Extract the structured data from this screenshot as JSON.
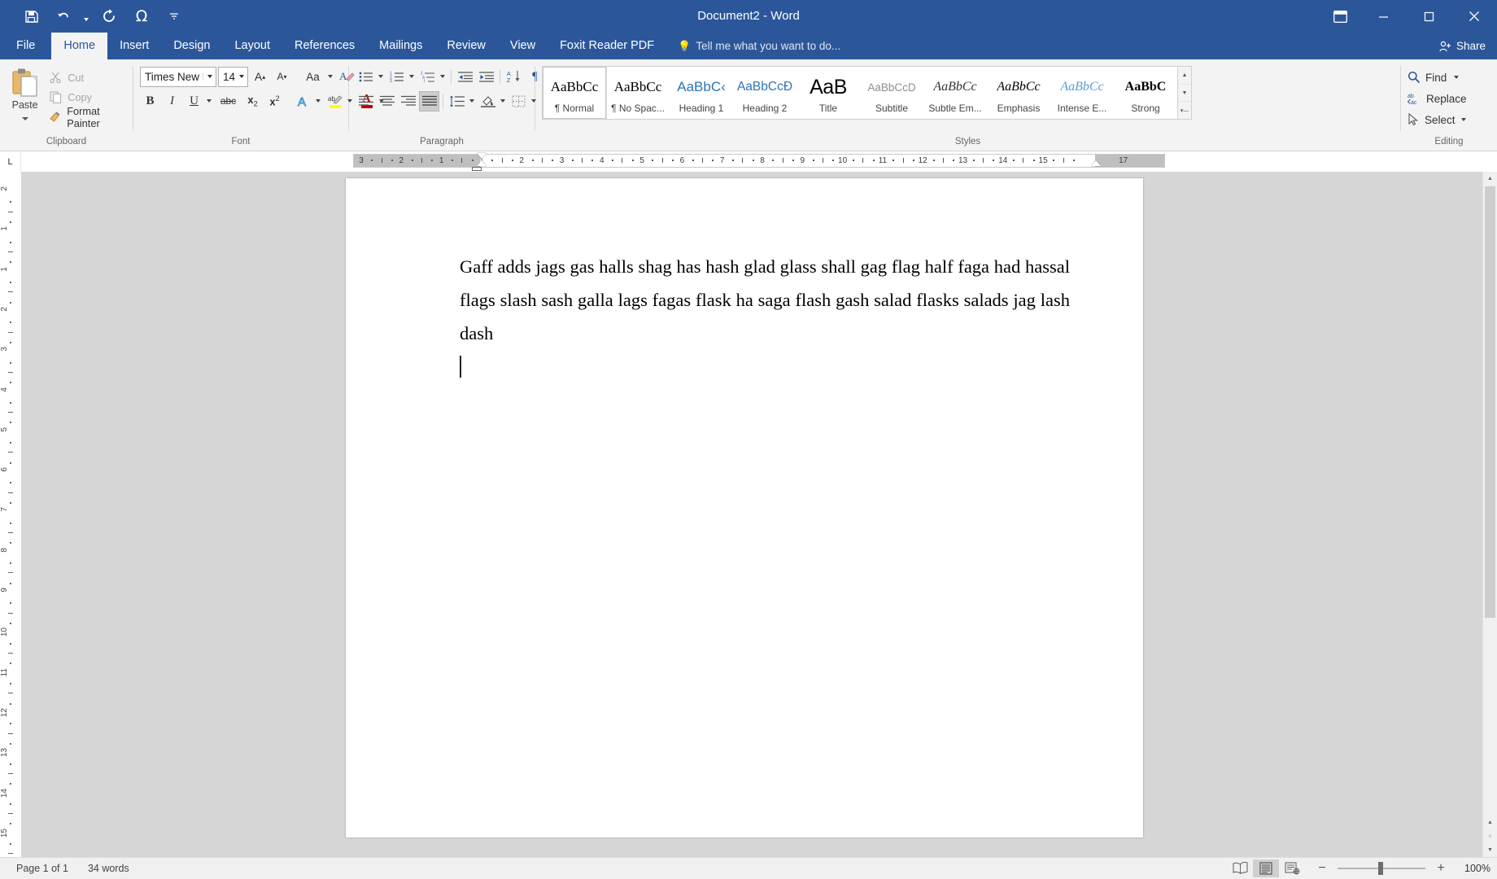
{
  "window": {
    "title": "Document2 - Word",
    "quick_access": [
      {
        "name": "save",
        "icon": "save-icon"
      },
      {
        "name": "undo",
        "icon": "undo-icon"
      },
      {
        "name": "redo",
        "icon": "redo-icon"
      },
      {
        "name": "symbol",
        "icon": "omega-icon",
        "glyph": "Ω"
      },
      {
        "name": "customize",
        "icon": "customize-qat-icon"
      }
    ],
    "controls": {
      "ribbon_display": "ribbon-display-options-icon",
      "minimize": "−",
      "restore": "❐",
      "close": "✕"
    }
  },
  "tabs": [
    {
      "label": "File",
      "active": false
    },
    {
      "label": "Home",
      "active": true
    },
    {
      "label": "Insert",
      "active": false
    },
    {
      "label": "Design",
      "active": false
    },
    {
      "label": "Layout",
      "active": false
    },
    {
      "label": "References",
      "active": false
    },
    {
      "label": "Mailings",
      "active": false
    },
    {
      "label": "Review",
      "active": false
    },
    {
      "label": "View",
      "active": false
    },
    {
      "label": "Foxit Reader PDF",
      "active": false
    }
  ],
  "tell_me": "Tell me what you want to do...",
  "share": "Share",
  "ribbon": {
    "clipboard": {
      "label": "Clipboard",
      "paste": "Paste",
      "commands": [
        {
          "label": "Cut",
          "icon": "scissors-icon",
          "enabled": false
        },
        {
          "label": "Copy",
          "icon": "copy-icon",
          "enabled": false
        },
        {
          "label": "Format Painter",
          "icon": "format-painter-icon",
          "enabled": true
        }
      ]
    },
    "font": {
      "label": "Font",
      "font_name": "Times New R‹",
      "font_name_full": "Times New Roman",
      "font_size": "14",
      "grow_font": "A",
      "shrink_font": "A",
      "change_case": "Aa",
      "clear_formatting": "clear-formatting-icon",
      "bold": "B",
      "italic": "I",
      "underline": "U",
      "strikethrough": "abc",
      "subscript": "x₂",
      "superscript": "x²",
      "text_effects": "A",
      "highlight": "ab",
      "font_color": "A",
      "highlight_color": "#ffff00",
      "font_color_value": "#c00000"
    },
    "paragraph": {
      "label": "Paragraph",
      "bullets": "bullets-icon",
      "numbering": "numbering-icon",
      "multilevel": "multilevel-list-icon",
      "decrease_indent": "decrease-indent-icon",
      "increase_indent": "increase-indent-icon",
      "sort": "sort-icon",
      "show_marks": "¶",
      "align_left": "align-left-icon",
      "align_center": "align-center-icon",
      "align_right": "align-right-icon",
      "justify": "justify-icon",
      "justify_active": true,
      "line_spacing": "line-spacing-icon",
      "shading": "shading-icon",
      "borders": "borders-icon"
    },
    "styles": {
      "label": "Styles",
      "items": [
        {
          "preview": "AaBbCc",
          "name": "¶ Normal",
          "kind": "normal",
          "selected": true
        },
        {
          "preview": "AaBbCc",
          "name": "¶ No Spac...",
          "kind": "nospace",
          "selected": false
        },
        {
          "preview": "AaBbC‹",
          "name": "Heading 1",
          "kind": "h1",
          "selected": false
        },
        {
          "preview": "AaBbCcĐ",
          "name": "Heading 2",
          "kind": "h2",
          "selected": false
        },
        {
          "preview": "AaB",
          "name": "Title",
          "kind": "title",
          "selected": false
        },
        {
          "preview": "AaBbCcD",
          "name": "Subtitle",
          "kind": "subtitle",
          "selected": false
        },
        {
          "preview": "AaBbCc",
          "name": "Subtle Em...",
          "kind": "subem",
          "selected": false
        },
        {
          "preview": "AaBbCc",
          "name": "Emphasis",
          "kind": "emph",
          "selected": false
        },
        {
          "preview": "AaBbCc",
          "name": "Intense E...",
          "kind": "intense",
          "selected": false
        },
        {
          "preview": "AaBbC",
          "name": "Strong",
          "kind": "strong",
          "selected": false
        }
      ]
    },
    "editing": {
      "label": "Editing",
      "find": "Find",
      "replace": "Replace",
      "select": "Select"
    }
  },
  "ruler": {
    "corner_tab": "L",
    "ticks": [
      "3",
      "2",
      "1",
      "1",
      "2",
      "3",
      "4",
      "5",
      "6",
      "7",
      "8",
      "9",
      "10",
      "11",
      "12",
      "13",
      "14",
      "15",
      "17"
    ],
    "vertical_ticks": [
      "2",
      "1",
      "1",
      "2",
      "3",
      "4",
      "5",
      "6",
      "7",
      "8",
      "9",
      "10",
      "11",
      "12",
      "13",
      "14",
      "15"
    ]
  },
  "document": {
    "paragraph": "Gaff adds jags gas halls shag has hash glad glass shall gag flag half faga had hassal flags slash sash galla lags fagas flask ha saga flash gash salad flasks salads jag lash dash"
  },
  "status": {
    "page": "Page 1 of 1",
    "words": "34 words",
    "views": [
      {
        "name": "read-mode",
        "icon": "read-mode-icon",
        "active": false
      },
      {
        "name": "print-layout",
        "icon": "print-layout-icon",
        "active": true
      },
      {
        "name": "web-layout",
        "icon": "web-layout-icon",
        "active": false
      }
    ],
    "zoom_out": "−",
    "zoom_in": "+",
    "zoom_level": "100%"
  }
}
